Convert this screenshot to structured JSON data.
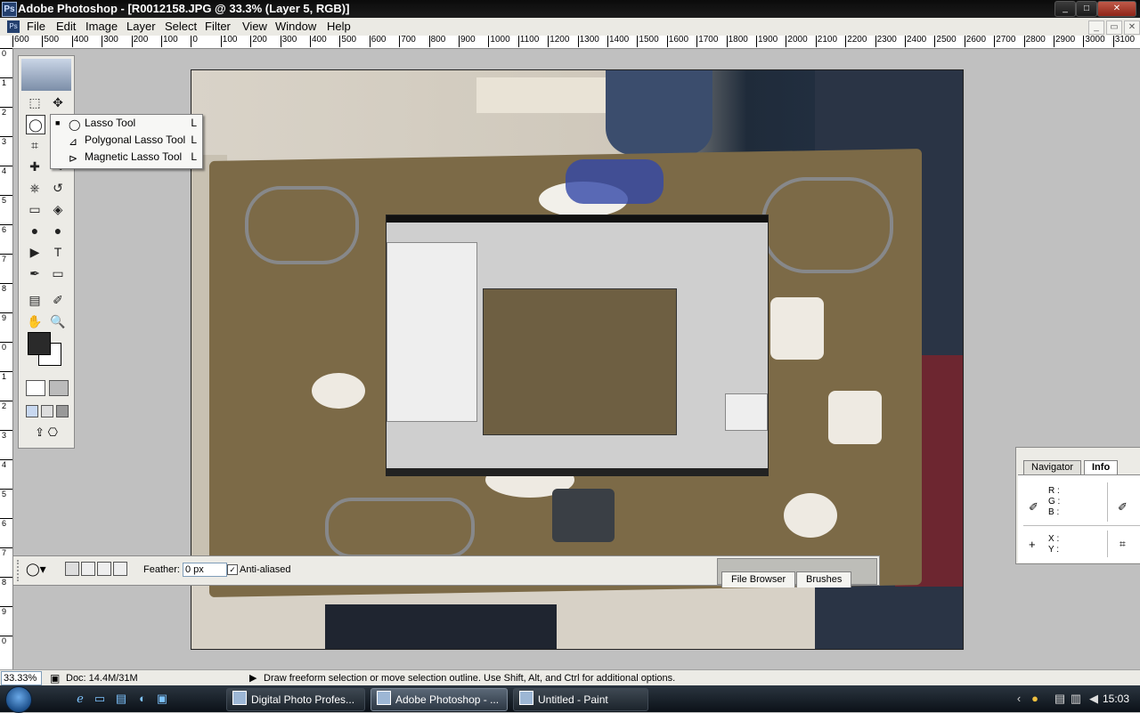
{
  "window": {
    "title": "Adobe Photoshop - [R0012158.JPG @ 33.3% (Layer 5, RGB)]",
    "app_icon": "Ps",
    "controls": {
      "minimize": "_",
      "maximize": "□",
      "close": "✕"
    }
  },
  "menu": {
    "items": [
      "File",
      "Edit",
      "Image",
      "Layer",
      "Select",
      "Filter",
      "View",
      "Window",
      "Help"
    ],
    "doc_controls": {
      "minimize": "_",
      "restore": "▭",
      "close": "✕"
    }
  },
  "ruler": {
    "h_ticks": [
      "600",
      "500",
      "400",
      "300",
      "200",
      "100",
      "0",
      "100",
      "200",
      "300",
      "400",
      "500",
      "600",
      "700",
      "800",
      "900",
      "1000",
      "1100",
      "1200",
      "1300",
      "1400",
      "1500",
      "1600",
      "1700",
      "1800",
      "1900",
      "2000",
      "2100",
      "2200",
      "2300",
      "2400",
      "2500",
      "2600",
      "2700",
      "2800",
      "2900",
      "3000",
      "3100"
    ],
    "v_ticks": [
      "0",
      "1",
      "2",
      "3",
      "4",
      "5",
      "6",
      "7",
      "8",
      "9",
      "0",
      "1",
      "2",
      "3",
      "4",
      "5",
      "6",
      "7",
      "8",
      "9",
      "0"
    ]
  },
  "tools": {
    "icons": [
      "marquee-icon",
      "move-icon",
      "lasso-icon",
      "magic-wand-icon",
      "crop-icon",
      "slice-icon",
      "healing-brush-icon",
      "brush-icon",
      "clone-stamp-icon",
      "history-brush-icon",
      "eraser-icon",
      "paint-bucket-icon",
      "blur-icon",
      "dodge-icon",
      "path-selection-icon",
      "type-icon",
      "pen-icon",
      "shape-icon",
      "notes-icon",
      "eyedropper-icon",
      "hand-icon",
      "zoom-icon"
    ],
    "glyphs": [
      "⬚",
      "✥",
      "◯",
      "✦",
      "⌗",
      "⊿",
      "✚",
      "✎",
      "⎈",
      "↺",
      "▭",
      "◈",
      "●",
      "●",
      "▶",
      "T",
      "✒",
      "▭",
      "▤",
      "✐",
      "✋",
      "🔍"
    ],
    "foreground_color": "#2a2a2a",
    "background_color": "#ffffff"
  },
  "lasso_flyout": {
    "items": [
      {
        "label": "Lasso Tool",
        "shortcut": "L",
        "selected": true
      },
      {
        "label": "Polygonal Lasso Tool",
        "shortcut": "L",
        "selected": false
      },
      {
        "label": "Magnetic Lasso Tool",
        "shortcut": "L",
        "selected": false
      }
    ],
    "bullet": "■"
  },
  "options_bar": {
    "feather_label": "Feather:",
    "feather_value": "0 px",
    "antialias_label": "Anti-aliased",
    "antialias_checked": true,
    "palette_tabs": [
      "File Browser",
      "Brushes"
    ]
  },
  "palette": {
    "tabs": [
      "Navigator",
      "Info"
    ],
    "active_tab": "Info",
    "rgb_labels": [
      "R :",
      "G :",
      "B :"
    ],
    "xy_labels": [
      "X :",
      "Y :"
    ]
  },
  "status": {
    "zoom": "33.33%",
    "doc": "Doc: 14.4M/31M",
    "hint": "Draw freeform selection or move selection outline.  Use Shift, Alt, and Ctrl for additional options."
  },
  "taskbar": {
    "buttons": [
      {
        "label": "Digital Photo Profes...",
        "active": false
      },
      {
        "label": "Adobe Photoshop - ...",
        "active": true
      },
      {
        "label": "Untitled - Paint",
        "active": false
      }
    ],
    "clock": "15:03",
    "colors": {
      "accent": "#1c4f8a"
    }
  }
}
